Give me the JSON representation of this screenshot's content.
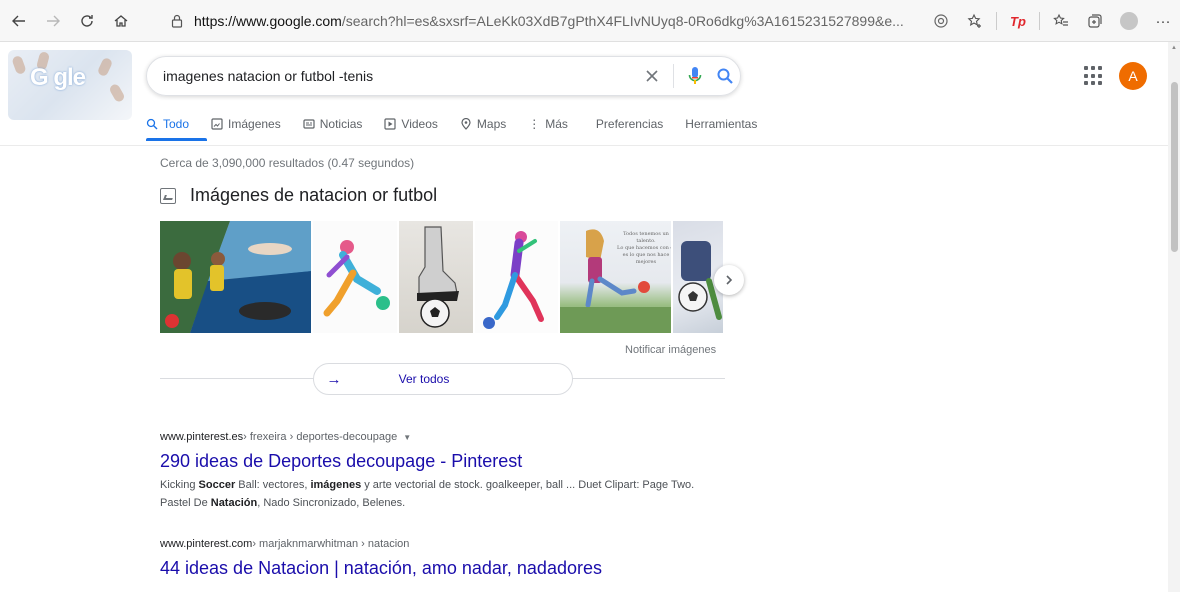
{
  "browser": {
    "url_domain": "https://www.google.com",
    "url_rest": "/search?hl=es&sxsrf=ALeKk03XdB7gPthX4FLIvNUyq8-0Ro6dkg%3A1615231527899&e..."
  },
  "google": {
    "doodle_text": "G gle",
    "query": "imagenes natacion or futbol -tenis",
    "avatar_letter": "A",
    "tabs": [
      {
        "label": "Todo",
        "icon": "search-icon"
      },
      {
        "label": "Imágenes",
        "icon": "image-icon"
      },
      {
        "label": "Noticias",
        "icon": "news-icon"
      },
      {
        "label": "Videos",
        "icon": "video-icon"
      },
      {
        "label": "Maps",
        "icon": "map-pin-icon"
      },
      {
        "label": "Más",
        "icon": "more-vert-icon"
      },
      {
        "label": "Preferencias",
        "icon": ""
      },
      {
        "label": "Herramientas",
        "icon": ""
      }
    ],
    "stats": "Cerca de 3,090,000 resultados (0.47 segundos)",
    "images_heading": "Imágenes de natacion or futbol",
    "notify_images": "Notificar imágenes",
    "see_all": "Ver todos",
    "results": [
      {
        "domain": "www.pinterest.es",
        "path": " › frexeira › deportes-decoupage",
        "title": "290 ideas de Deportes decoupage - Pinterest",
        "snippet_parts": [
          {
            "t": "Kicking ",
            "b": false
          },
          {
            "t": "Soccer",
            "b": true
          },
          {
            "t": " Ball: vectores, ",
            "b": false
          },
          {
            "t": "imágenes",
            "b": true
          },
          {
            "t": " y arte vectorial de stock. goalkeeper, ball ... Duet Clipart: Page Two. Pastel De ",
            "b": false
          },
          {
            "t": "Natación",
            "b": true
          },
          {
            "t": ", Nado Sincronizado, Belenes.",
            "b": false
          }
        ]
      },
      {
        "domain": "www.pinterest.com",
        "path": " › marjaknmarwhitman › natacion",
        "title": "44 ideas de Natacion | natación, amo nadar, nadadores"
      }
    ]
  },
  "colors": {
    "link": "#1a0dab",
    "active_tab": "#1a73e8",
    "avatar": "#ef6c00"
  }
}
